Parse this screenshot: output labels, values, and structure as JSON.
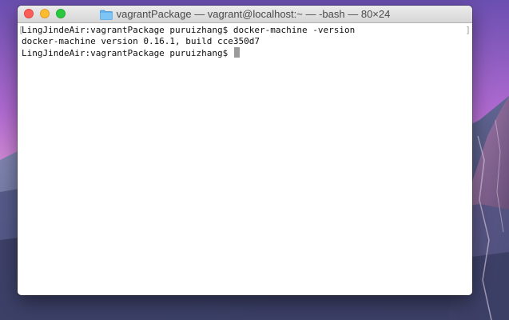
{
  "window": {
    "title": "vagrantPackage — vagrant@localhost:~ — -bash — 80×24",
    "folder_icon": "folder-icon",
    "controls": [
      "close-button",
      "minimize-button",
      "zoom-button"
    ]
  },
  "terminal": {
    "lines": [
      "LingJindeAir:vagrantPackage puruizhang$ docker-machine -version",
      "docker-machine version 0.16.1, build cce350d7",
      "LingJindeAir:vagrantPackage puruizhang$ "
    ],
    "left_bracket": "[",
    "right_bracket": "]"
  },
  "colors": {
    "close": "#fc5f57",
    "minimize": "#fdbc2e",
    "zoom": "#28c840",
    "cursor": "#9b9b9b"
  }
}
